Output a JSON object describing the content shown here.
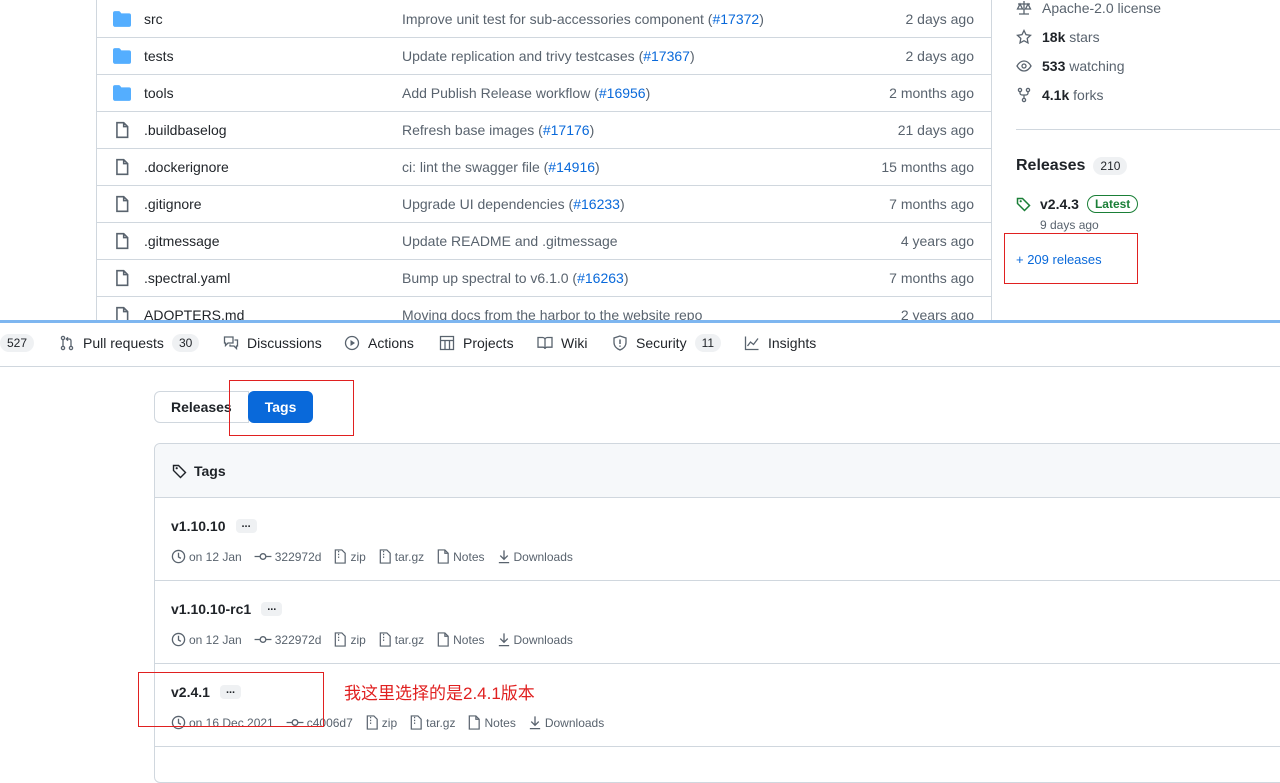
{
  "files": [
    {
      "name": "src",
      "type": "folder",
      "msg": "Improve unit test for sub-accessories component (",
      "pr": "#17372",
      "msg_end": ")",
      "age": "2 days ago"
    },
    {
      "name": "tests",
      "type": "folder",
      "msg": "Update replication and trivy testcases (",
      "pr": "#17367",
      "msg_end": ")",
      "age": "2 days ago"
    },
    {
      "name": "tools",
      "type": "folder",
      "msg": "Add Publish Release workflow (",
      "pr": "#16956",
      "msg_end": ")",
      "age": "2 months ago"
    },
    {
      "name": ".buildbaselog",
      "type": "file",
      "msg": "Refresh base images (",
      "pr": "#17176",
      "msg_end": ")",
      "age": "21 days ago"
    },
    {
      "name": ".dockerignore",
      "type": "file",
      "msg": "ci: lint the swagger file (",
      "pr": "#14916",
      "msg_end": ")",
      "age": "15 months ago"
    },
    {
      "name": ".gitignore",
      "type": "file",
      "msg": "Upgrade UI dependencies (",
      "pr": "#16233",
      "msg_end": ")",
      "age": "7 months ago"
    },
    {
      "name": ".gitmessage",
      "type": "file",
      "msg": "Update README and .gitmessage",
      "pr": "",
      "msg_end": "",
      "age": "4 years ago"
    },
    {
      "name": ".spectral.yaml",
      "type": "file",
      "msg": "Bump up spectral to v6.1.0 (",
      "pr": "#16263",
      "msg_end": ")",
      "age": "7 months ago"
    },
    {
      "name": "ADOPTERS.md",
      "type": "file",
      "msg": "Moving docs from the harbor to the website repo",
      "pr": "",
      "msg_end": "",
      "age": "2 years ago"
    }
  ],
  "sidebar": {
    "license": "Apache-2.0 license",
    "stars_count": "18k",
    "stars_label": "stars",
    "watching_count": "533",
    "watching_label": "watching",
    "forks_count": "4.1k",
    "forks_label": "forks",
    "releases_title": "Releases",
    "releases_count": "210",
    "latest_version": "v2.4.3",
    "latest_badge": "Latest",
    "latest_date": "9 days ago",
    "more_releases": "+ 209 releases"
  },
  "nav": {
    "issues_count": "527",
    "pull_requests": "Pull requests",
    "pull_requests_count": "30",
    "discussions": "Discussions",
    "actions": "Actions",
    "projects": "Projects",
    "wiki": "Wiki",
    "security": "Security",
    "security_count": "11",
    "insights": "Insights"
  },
  "toggle": {
    "releases": "Releases",
    "tags": "Tags"
  },
  "tags_header": "Tags",
  "tags": [
    {
      "name": "v1.10.10",
      "date": "on 12 Jan",
      "commit": "322972d",
      "zip": "zip",
      "targz": "tar.gz",
      "notes": "Notes",
      "downloads": "Downloads"
    },
    {
      "name": "v1.10.10-rc1",
      "date": "on 12 Jan",
      "commit": "322972d",
      "zip": "zip",
      "targz": "tar.gz",
      "notes": "Notes",
      "downloads": "Downloads"
    },
    {
      "name": "v2.4.1",
      "date": "on 16 Dec 2021",
      "commit": "c4006d7",
      "zip": "zip",
      "targz": "tar.gz",
      "notes": "Notes",
      "downloads": "Downloads"
    }
  ],
  "ellipsis": "...",
  "annotation": "我这里选择的是2.4.1版本",
  "colors": {
    "link": "#0969da",
    "annotation_red": "#e02020",
    "folder": "#54aeff",
    "latest_green": "#1a7f37"
  }
}
